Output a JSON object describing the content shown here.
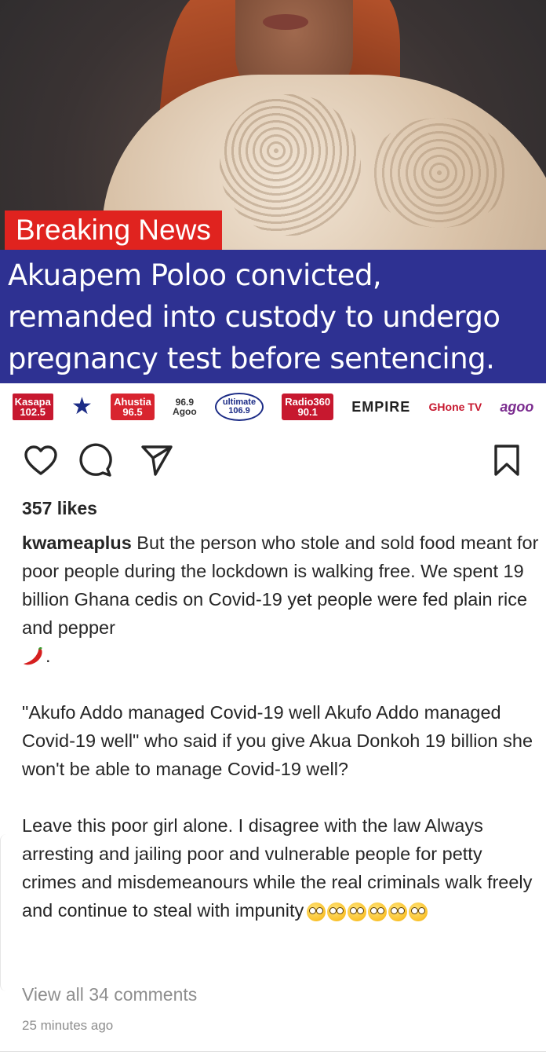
{
  "post": {
    "banner_label": "Breaking News",
    "headline_lines": [
      "Akuapem Poloo convicted,",
      "remanded into custody to undergo",
      "pregnancy test before sentencing."
    ],
    "logos": [
      "Kasapa 102.5",
      "Star",
      "Ahustia 96.5",
      "Agoo",
      "ultimate 106.9",
      "Radio 360 90.1",
      "EMPIRE 102.7fm",
      "GHone TV",
      "agoo"
    ]
  },
  "actions": {
    "like_icon": "heart-icon",
    "comment_icon": "comment-icon",
    "share_icon": "paper-plane-icon",
    "save_icon": "bookmark-icon"
  },
  "likes": "357 likes",
  "caption": {
    "username": "kwameaplus",
    "para1": "But the person who stole and sold food meant for poor people during the lockdown is walking free. We spent 19 billion Ghana cedis on Covid-19 yet people were fed plain rice and pepper",
    "para1_end": ".",
    "para2": "\"Akufo Addo managed Covid-19 well Akufo Addo managed Covid-19 well\" who said if you give Akua Donkoh 19 billion she won't be able to manage Covid-19 well?",
    "para3": "Leave this poor girl alone. I disagree with the law Always arresting and jailing poor and vulnerable people for petty crimes and misdemeanours while the real criminals walk freely and continue to steal with impunity"
  },
  "view_comments": "View all 34 comments",
  "timestamp": "25 minutes ago",
  "colors": {
    "banner_red": "#e0231f",
    "banner_blue": "#2e3192",
    "text": "#262626",
    "muted": "#8e8e8e"
  }
}
